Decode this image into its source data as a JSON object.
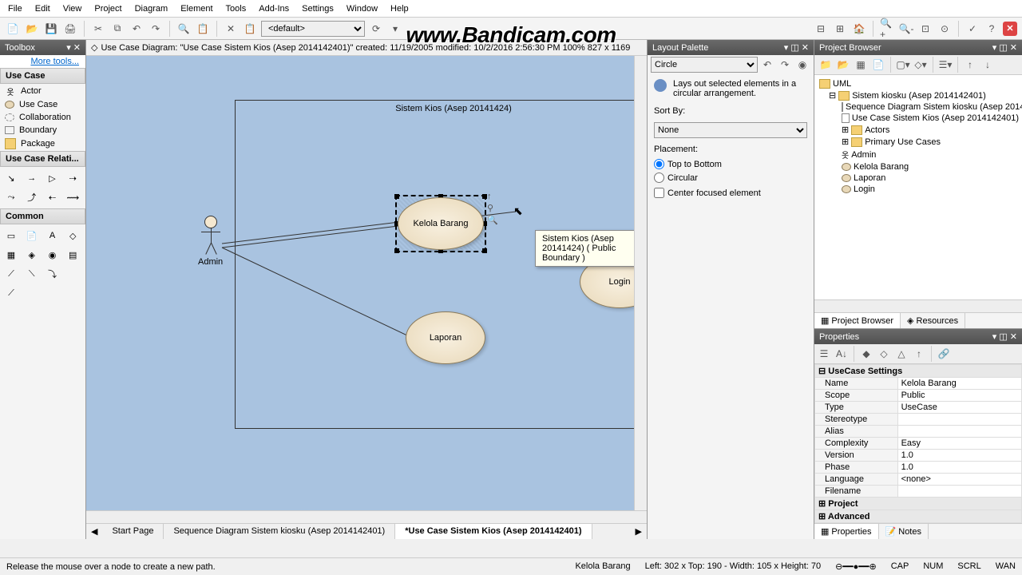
{
  "menu": [
    "File",
    "Edit",
    "View",
    "Project",
    "Diagram",
    "Element",
    "Tools",
    "Add-Ins",
    "Settings",
    "Window",
    "Help"
  ],
  "watermark": "www.Bandicam.com",
  "toolbar": {
    "default_style": "<default>"
  },
  "diagram": {
    "info": "Use Case Diagram: \"Use Case Sistem Kios (Asep 2014142401)\"   created: 11/19/2005   modified: 10/2/2016 2:56:30 PM   100%   827 x 1169",
    "boundary_title": "Sistem Kios (Asep 20141424)",
    "actor": "Admin",
    "usecases": {
      "kelola": "Kelola Barang",
      "laporan": "Laporan",
      "login": "Login"
    },
    "tooltip": "Sistem Kios (Asep 20141424) ( Public Boundary )",
    "tabs": [
      "Start Page",
      "Sequence Diagram Sistem kiosku (Asep 2014142401)",
      "*Use Case Sistem Kios (Asep 2014142401)"
    ]
  },
  "toolbox": {
    "header": "Toolbox",
    "more": "More tools...",
    "usecase_header": "Use Case",
    "usecase_items": [
      "Actor",
      "Use Case",
      "Collaboration",
      "Boundary",
      "Package"
    ],
    "relations_header": "Use Case Relati...",
    "common_header": "Common"
  },
  "layout": {
    "header": "Layout Palette",
    "style": "Circle",
    "desc": "Lays out selected elements in a circular arrangement.",
    "sortby_label": "Sort By:",
    "sortby_value": "None",
    "placement_label": "Placement:",
    "top_to_bottom": "Top to Bottom",
    "circular": "Circular",
    "center_focused": "Center focused element"
  },
  "browser": {
    "header": "Project Browser",
    "root": "UML",
    "model": "Sistem kiosku (Asep 2014142401)",
    "seq": "Sequence Diagram Sistem kiosku (Asep 2014",
    "uc_diag": "Use Case Sistem Kios (Asep 2014142401)",
    "actors_pkg": "Actors",
    "primary_pkg": "Primary Use Cases",
    "items": [
      "Admin",
      "Kelola Barang",
      "Laporan",
      "Login"
    ],
    "tabs": [
      "Project Browser",
      "Resources"
    ]
  },
  "props": {
    "header": "Properties",
    "section1": "UseCase Settings",
    "rows": [
      [
        "Name",
        "Kelola Barang"
      ],
      [
        "Scope",
        "Public"
      ],
      [
        "Type",
        "UseCase"
      ],
      [
        "Stereotype",
        ""
      ],
      [
        "Alias",
        ""
      ],
      [
        "Complexity",
        "Easy"
      ],
      [
        "Version",
        "1.0"
      ],
      [
        "Phase",
        "1.0"
      ],
      [
        "Language",
        "<none>"
      ],
      [
        "Filename",
        ""
      ]
    ],
    "section2": "Project",
    "section3": "Advanced",
    "tabs": [
      "Properties",
      "Notes"
    ]
  },
  "status": {
    "left": "Release the mouse over a node to create a new path.",
    "element": "Kelola Barang",
    "coords": "Left:  302 x Top:   190 - Width:  105 x Height:   70",
    "indicators": [
      "CAP",
      "NUM",
      "SCRL",
      "WAN"
    ]
  }
}
